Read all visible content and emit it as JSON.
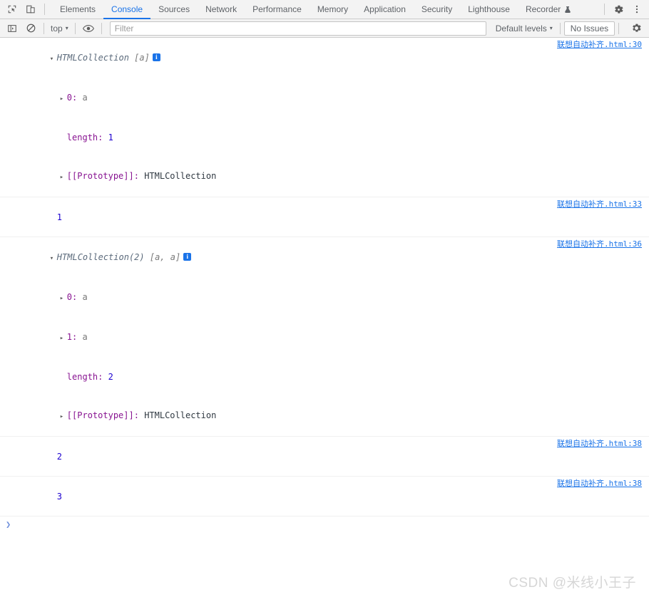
{
  "devtools": {
    "left_icons": [
      {
        "name": "inspect-element-icon",
        "glyph": "inspect"
      },
      {
        "name": "device-toolbar-icon",
        "glyph": "device"
      }
    ],
    "tabs": [
      {
        "label": "Elements",
        "active": false
      },
      {
        "label": "Console",
        "active": true
      },
      {
        "label": "Sources",
        "active": false
      },
      {
        "label": "Network",
        "active": false
      },
      {
        "label": "Performance",
        "active": false
      },
      {
        "label": "Memory",
        "active": false
      },
      {
        "label": "Application",
        "active": false
      },
      {
        "label": "Security",
        "active": false
      },
      {
        "label": "Lighthouse",
        "active": false
      },
      {
        "label": "Recorder",
        "active": false,
        "badge_icon": "flask-icon"
      }
    ],
    "right_icons": [
      {
        "name": "settings-gear-icon"
      },
      {
        "name": "more-options-icon"
      }
    ]
  },
  "console_toolbar": {
    "sidebar_toggle_icon": "console-sidebar-icon",
    "clear_icon": "clear-console-icon",
    "context_label": "top",
    "context_caret": "▾",
    "eye_icon": "live-expression-eye-icon",
    "filter_placeholder": "Filter",
    "filter_value": "",
    "levels_label": "Default levels",
    "levels_caret": "▾",
    "issues_label": "No Issues",
    "settings_icon": "console-settings-gear-icon"
  },
  "console_messages": [
    {
      "id": "msg-htmlcollection-1",
      "type": "object",
      "triangle": "▾",
      "title_prefix": "HTMLCollection ",
      "title_brackets": "[a]",
      "has_info_badge": true,
      "children": [
        {
          "triangle": "▸",
          "key": "0:",
          "value": "a",
          "value_kind": "gray"
        },
        {
          "triangle": "",
          "key": "length:",
          "value": "1",
          "value_kind": "number"
        },
        {
          "triangle": "▸",
          "key": "[[Prototype]]:",
          "value": "HTMLCollection",
          "value_kind": "proto"
        }
      ],
      "source": "联想自动补齐.html:30"
    },
    {
      "id": "msg-number-1",
      "type": "value",
      "value": "1",
      "source": "联想自动补齐.html:33"
    },
    {
      "id": "msg-htmlcollection-2",
      "type": "object",
      "triangle": "▾",
      "title_prefix": "HTMLCollection(2) ",
      "title_brackets": "[a, a]",
      "has_info_badge": true,
      "children": [
        {
          "triangle": "▸",
          "key": "0:",
          "value": "a",
          "value_kind": "gray"
        },
        {
          "triangle": "▸",
          "key": "1:",
          "value": "a",
          "value_kind": "gray"
        },
        {
          "triangle": "",
          "key": "length:",
          "value": "2",
          "value_kind": "number"
        },
        {
          "triangle": "▸",
          "key": "[[Prototype]]:",
          "value": "HTMLCollection",
          "value_kind": "proto"
        }
      ],
      "source": "联想自动补齐.html:36"
    },
    {
      "id": "msg-number-2",
      "type": "value",
      "value": "2",
      "source": "联想自动补齐.html:38"
    },
    {
      "id": "msg-number-3",
      "type": "value",
      "value": "3",
      "source": "联想自动补齐.html:38"
    }
  ],
  "prompt": {
    "arrow": "❯",
    "value": ""
  },
  "watermark": {
    "text": "CSDN @米线小王子"
  },
  "colors": {
    "accent": "#1a73e8",
    "toolbar_bg": "#f3f3f3",
    "border": "#cdcdcd",
    "key_purple": "#881391",
    "number_blue": "#1c00cf",
    "object_name": "#5c6b7c",
    "link_blue": "#1a73e8",
    "watermark": "#d6d6d6"
  }
}
